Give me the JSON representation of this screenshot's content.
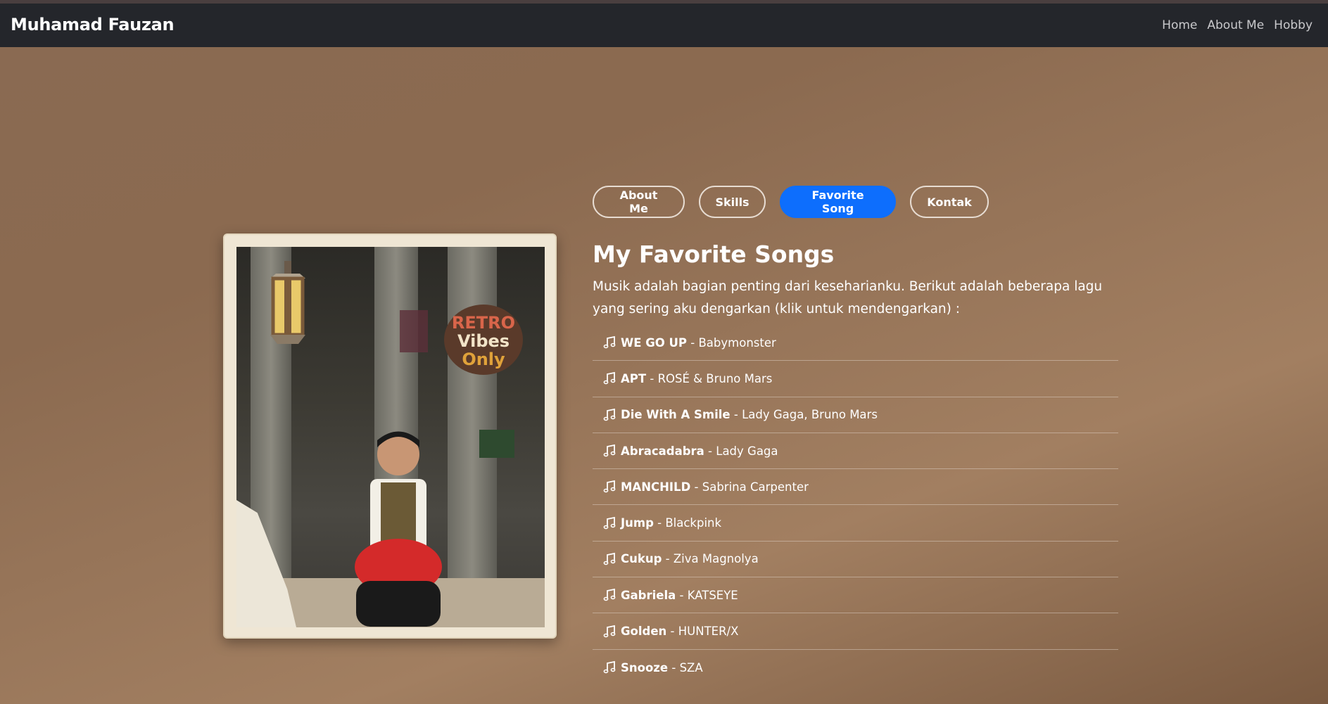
{
  "navbar": {
    "brand": "Muhamad Fauzan",
    "links": [
      "Home",
      "About Me",
      "Hobby"
    ]
  },
  "tabs": [
    {
      "label": "About Me",
      "active": false
    },
    {
      "label": "Skills",
      "active": false
    },
    {
      "label": "Favorite Song",
      "active": true
    },
    {
      "label": "Kontak",
      "active": false
    }
  ],
  "section": {
    "title": "My Favorite Songs",
    "description": "Musik adalah bagian penting dari kesehari­anku. Berikut adalah beberapa lagu yang sering aku dengarkan (klik untuk mendengarkan) :"
  },
  "songs": [
    {
      "title": "WE GO UP",
      "separator": " - ",
      "artist": "Babymonster"
    },
    {
      "title": "APT",
      "separator": " - ",
      "artist": "ROSÉ & Bruno Mars"
    },
    {
      "title": "Die With A Smile",
      "separator": " - ",
      "artist": "Lady Gaga, Bruno Mars"
    },
    {
      "title": "Abracadabra",
      "separator": " - ",
      "artist": "Lady Gaga"
    },
    {
      "title": "MANCHILD",
      "separator": " - ",
      "artist": "Sabrina Carpenter"
    },
    {
      "title": "Jump",
      "separator": " - ",
      "artist": "Blackpink"
    },
    {
      "title": "Cukup",
      "separator": " - ",
      "artist": "Ziva Magnolya"
    },
    {
      "title": "Gabriela",
      "separator": " - ",
      "artist": "KATSEYE"
    },
    {
      "title": "Golden",
      "separator": " - ",
      "artist": "HUNTER/X"
    },
    {
      "title": "Snooze",
      "separator": " - ",
      "artist": "SZA"
    }
  ],
  "photo": {
    "sticker_lines": [
      "RETRO",
      "Vibes",
      "Only"
    ]
  },
  "colors": {
    "active_tab": "#0d6efd",
    "navbar_bg": "#24262b"
  },
  "icons": {
    "song": "music-note-icon"
  }
}
